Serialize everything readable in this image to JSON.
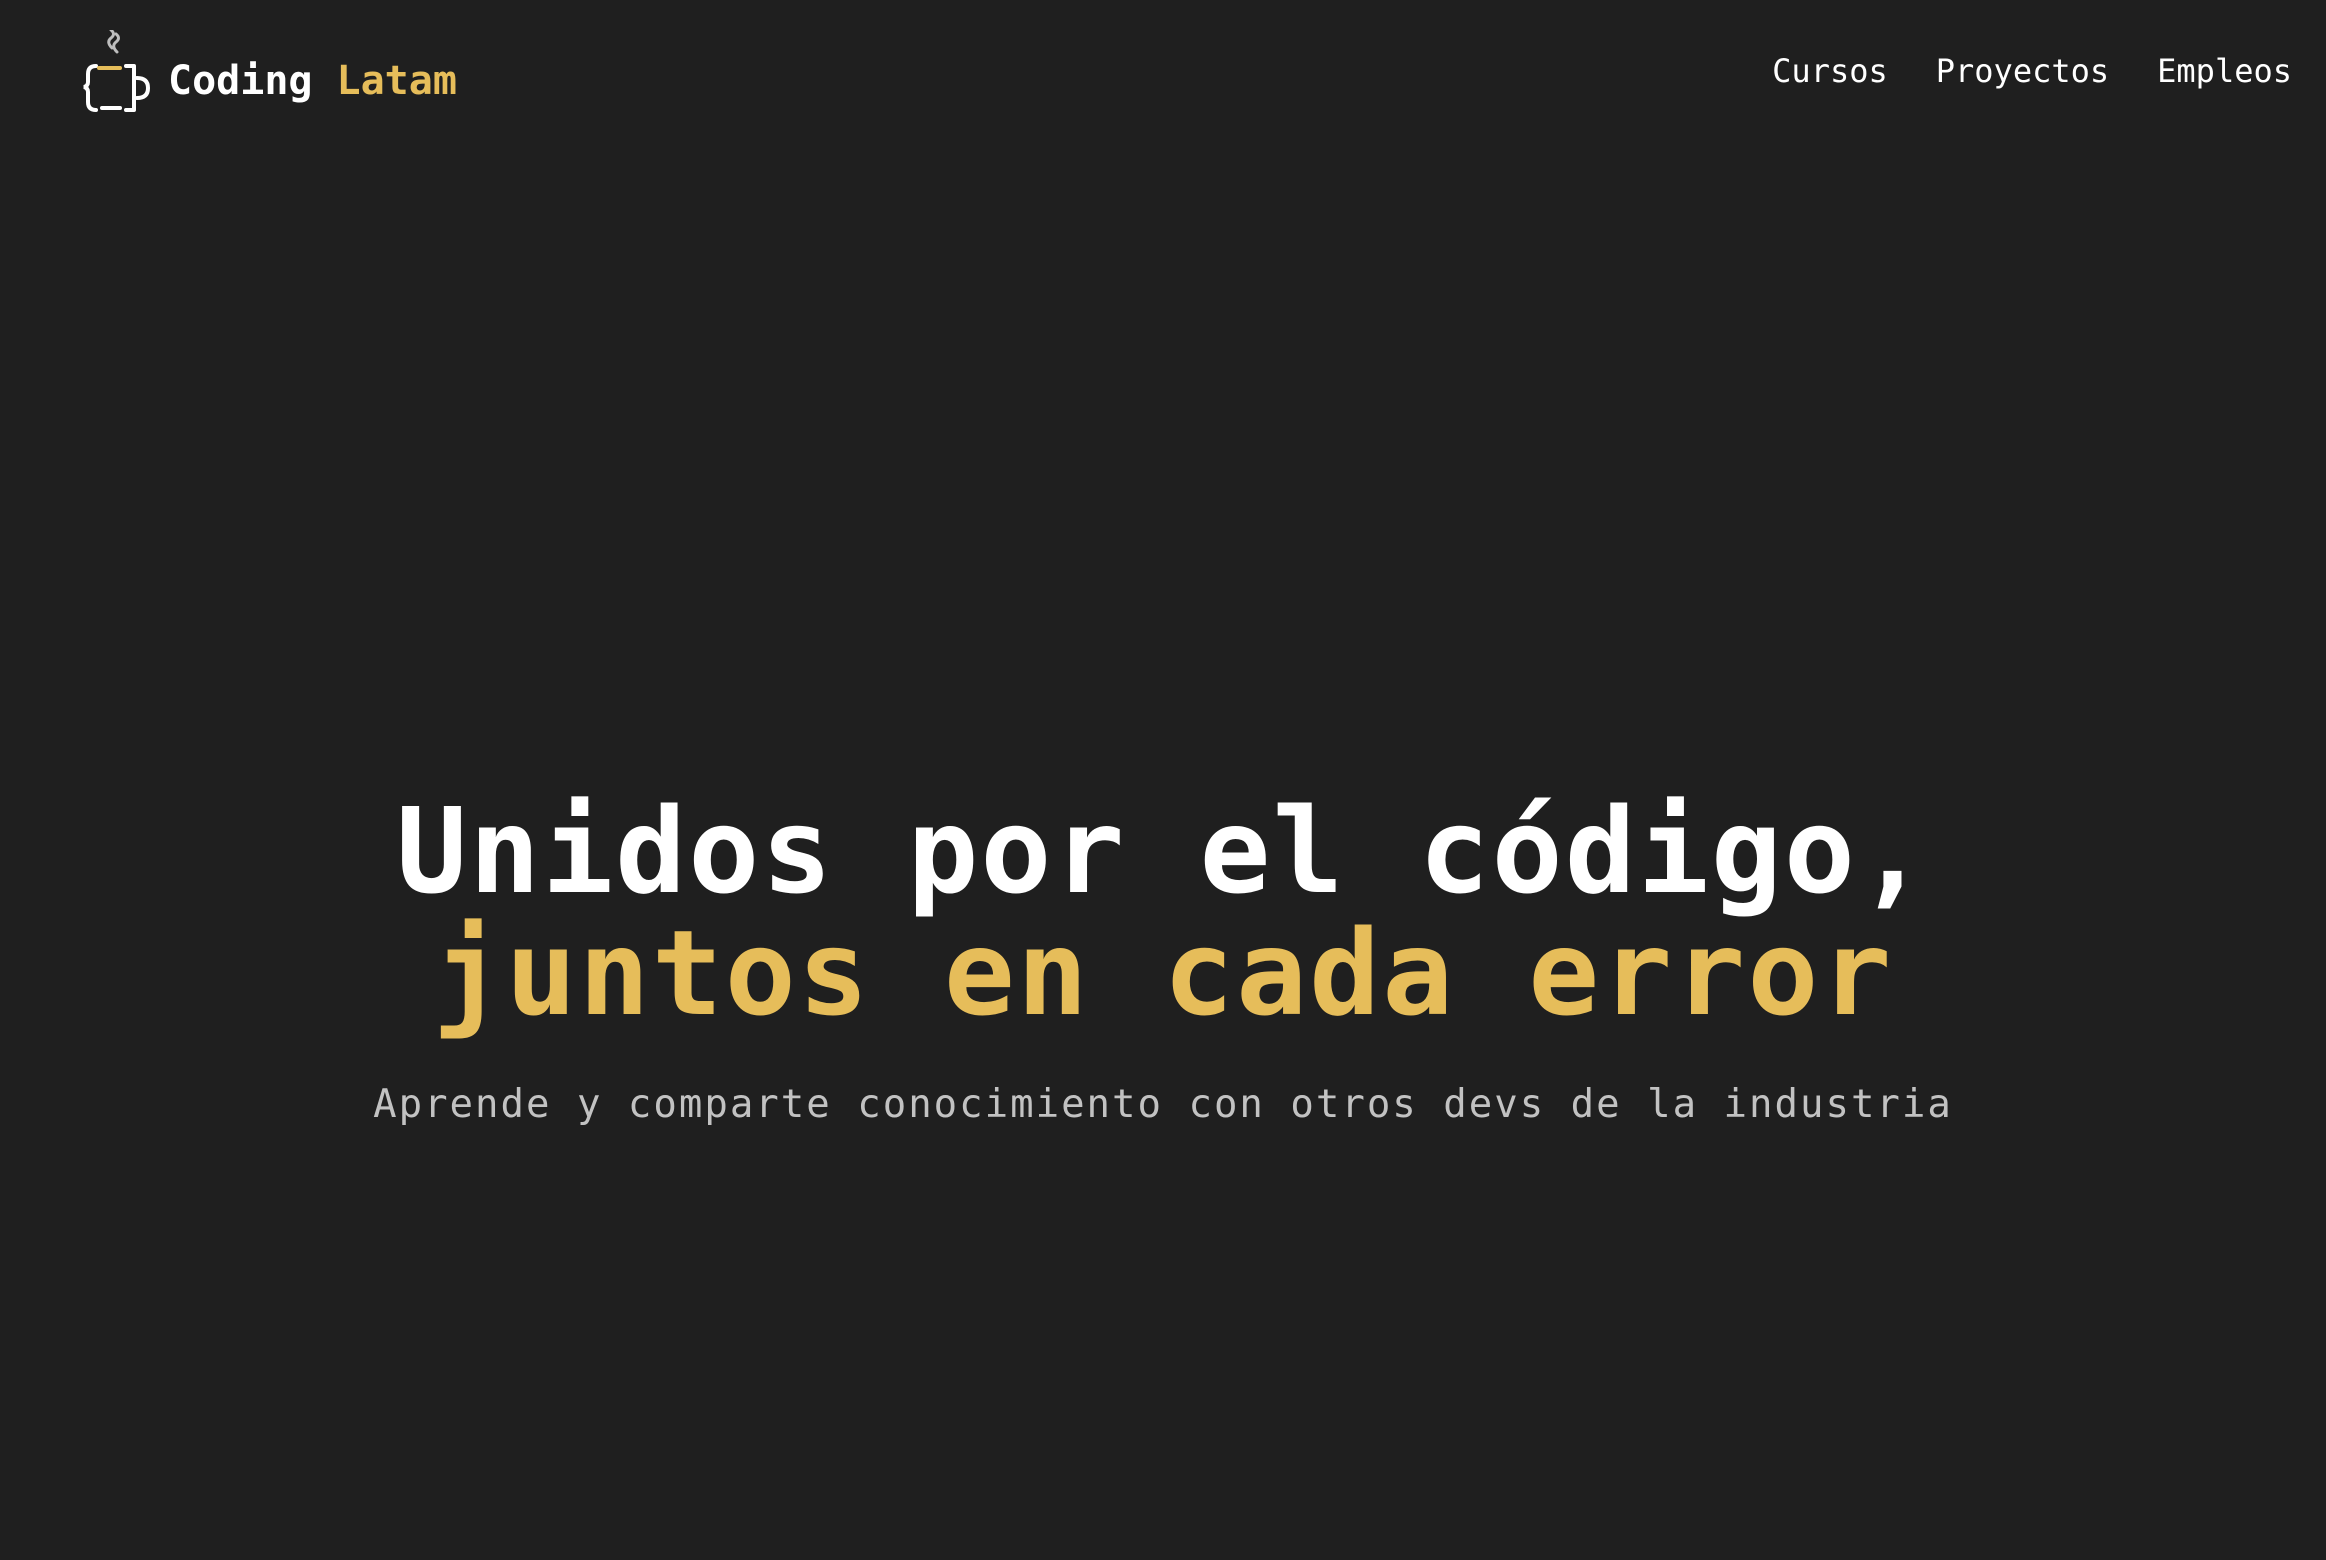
{
  "brand": {
    "name_part1": "Coding",
    "name_part2": "Latam",
    "accent_color": "#e6bd5a",
    "logo_icon": "coffee-mug-code-icon"
  },
  "nav": {
    "items": [
      {
        "label": "Cursos"
      },
      {
        "label": "Proyectos"
      },
      {
        "label": "Empleos"
      }
    ]
  },
  "hero": {
    "title_line1": "Unidos por el código,",
    "title_line2": "juntos en cada error",
    "subtitle": "Aprende y comparte conocimiento con otros devs de la industria"
  },
  "colors": {
    "background": "#1f1f1f",
    "text": "#ffffff",
    "muted": "#c2c2c2"
  }
}
